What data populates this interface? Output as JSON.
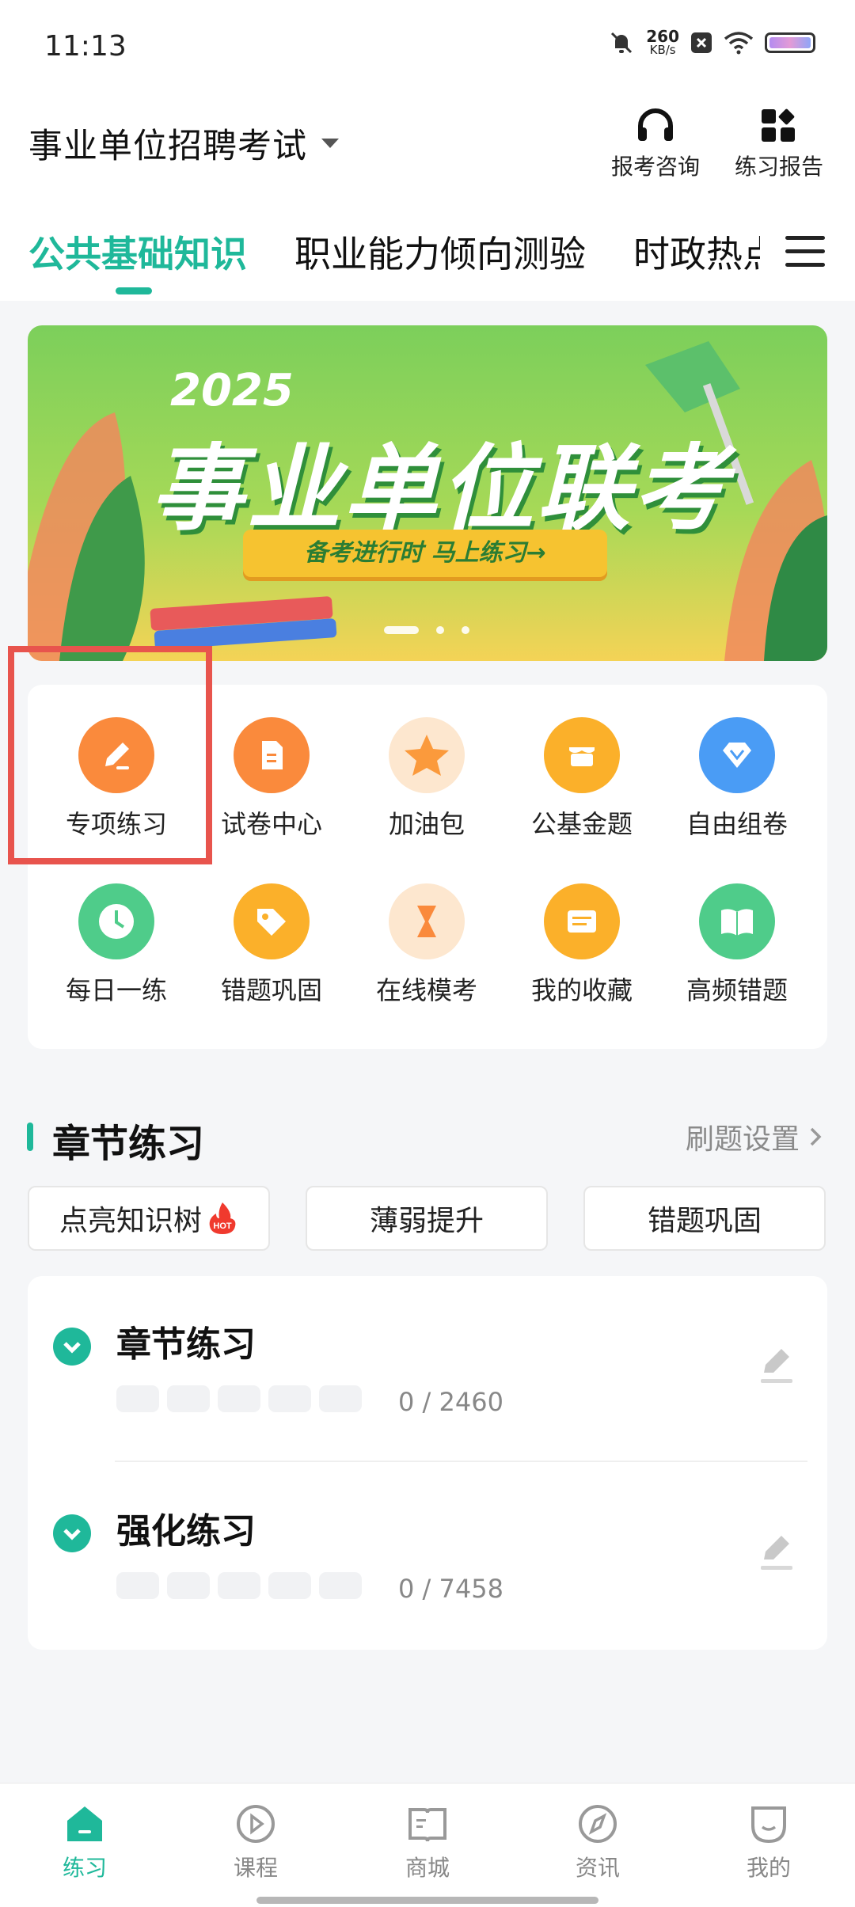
{
  "status_bar": {
    "time": "11:13",
    "net_speed": "260",
    "net_unit": "KB/s"
  },
  "header": {
    "exam_title": "事业单位招聘考试",
    "consult_label": "报考咨询",
    "report_label": "练习报告"
  },
  "tabs": [
    {
      "label": "公共基础知识",
      "active": true
    },
    {
      "label": "职业能力倾向测验",
      "active": false
    },
    {
      "label": "时政热点",
      "active": false
    }
  ],
  "banner": {
    "year": "2025",
    "title": "事业单位联考",
    "cta": "备考进行时 马上练习→"
  },
  "grid": [
    {
      "label": "专项练习",
      "icon": "pencil-icon",
      "color": "#fa8a3c"
    },
    {
      "label": "试卷中心",
      "icon": "document-icon",
      "color": "#fa8a3c"
    },
    {
      "label": "加油包",
      "icon": "star-icon",
      "color": "#fdb14a"
    },
    {
      "label": "公基金题",
      "icon": "shop-icon",
      "color": "#fbb02a"
    },
    {
      "label": "自由组卷",
      "icon": "diamond-icon",
      "color": "#4a9cf5"
    },
    {
      "label": "每日一练",
      "icon": "clock-icon",
      "color": "#4fcc8a"
    },
    {
      "label": "错题巩固",
      "icon": "tag-icon",
      "color": "#fbb02a"
    },
    {
      "label": "在线模考",
      "icon": "hourglass-icon",
      "color": "#fa8a3c"
    },
    {
      "label": "我的收藏",
      "icon": "list-icon",
      "color": "#fbb02a"
    },
    {
      "label": "高频错题",
      "icon": "book-icon",
      "color": "#4fcc8a"
    }
  ],
  "section": {
    "title": "章节练习",
    "setting": "刷题设置"
  },
  "chips": [
    {
      "label": "点亮知识树",
      "badge": "HOT"
    },
    {
      "label": "薄弱提升"
    },
    {
      "label": "错题巩固"
    }
  ],
  "practice": [
    {
      "title": "章节练习",
      "count": "0 / 2460"
    },
    {
      "title": "强化练习",
      "count": "0 / 7458"
    }
  ],
  "bottom_nav": [
    {
      "label": "练习",
      "icon": "home-icon",
      "active": true
    },
    {
      "label": "课程",
      "icon": "play-icon",
      "active": false
    },
    {
      "label": "商城",
      "icon": "shop-book-icon",
      "active": false
    },
    {
      "label": "资讯",
      "icon": "compass-icon",
      "active": false
    },
    {
      "label": "我的",
      "icon": "profile-icon",
      "active": false
    }
  ],
  "colors": {
    "accent": "#1fb89a",
    "highlight": "#e8544d"
  }
}
